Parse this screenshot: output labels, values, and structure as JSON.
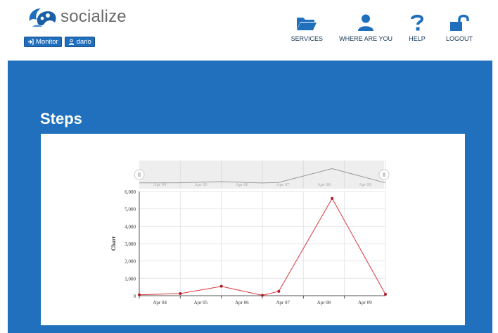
{
  "app": {
    "logo_text": "socialize"
  },
  "badges": [
    {
      "label": "Monitor",
      "icon": "sign-in-icon"
    },
    {
      "label": "dario",
      "icon": "user-icon"
    }
  ],
  "nav": [
    {
      "label": "SERVICES",
      "icon": "folder-open-icon"
    },
    {
      "label": "WHERE ARE YOU",
      "icon": "user-icon"
    },
    {
      "label": "HELP",
      "icon": "question-icon"
    },
    {
      "label": "LOGOUT",
      "icon": "unlock-icon"
    }
  ],
  "colors": {
    "brand_blue": "#2070bd",
    "series_red": "#d9363e",
    "navigator_line": "#999999"
  },
  "main": {
    "title": "Steps"
  },
  "chart_data": {
    "type": "line",
    "categories": [
      "Apr 04",
      "Apr 05",
      "Apr 06",
      "Apr 07",
      "Apr 08",
      "Apr 09"
    ],
    "x": [
      "Apr 04",
      "Apr 05",
      "Apr 06",
      "Apr 07 (early)",
      "Apr 07",
      "Apr 08",
      "Apr 09"
    ],
    "series": [
      {
        "name": "",
        "values": [
          50,
          120,
          540,
          20,
          250,
          5600,
          80
        ]
      }
    ],
    "ylabel": "Chart",
    "ylim": [
      0,
      6000
    ],
    "yticks": [
      0,
      1000,
      2000,
      3000,
      4000,
      5000,
      6000
    ],
    "ytick_labels": [
      "0",
      "1,000",
      "2,000",
      "3,000",
      "4,000",
      "5,000",
      "6,000"
    ],
    "navigator": true,
    "grid": true
  }
}
